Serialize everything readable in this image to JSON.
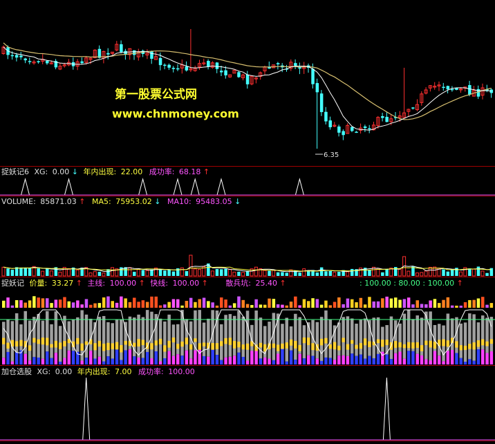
{
  "watermark": {
    "title": "第一股票公式网",
    "url": "www.chnmoney.com"
  },
  "colors": {
    "up": "#ff3030",
    "down": "#44ffff",
    "ma_yellow": "#d8c070",
    "ma_white": "#ffffff",
    "separator": "#c00000",
    "label_white": "#e0e0e0",
    "label_yellow": "#ffff40",
    "label_magenta": "#ff55ff",
    "label_cyan": "#44ffff"
  },
  "panels": {
    "price": {
      "low_marker": "6.35"
    },
    "panel1": {
      "name": "捉妖记6",
      "xg_label": "XG:",
      "xg_value": "0.00",
      "xg_arrow": "↓",
      "year_label": "年内出现:",
      "year_value": "22.00",
      "rate_label": "成功率:",
      "rate_value": "68.18",
      "rate_arrow": "↑"
    },
    "volume": {
      "vol_label": "VOLUME:",
      "vol_value": "85871.03",
      "vol_arrow": "↑",
      "ma5_label": "MA5:",
      "ma5_value": "75953.02",
      "ma5_arrow": "↓",
      "ma10_label": "MA10:",
      "ma10_value": "95483.05",
      "ma10_arrow": "↓"
    },
    "panel3": {
      "name": "捉妖记",
      "price_label": "价量:",
      "price_value": "33.27",
      "price_arrow": "↑",
      "main_label": "主线:",
      "main_value": "100.00",
      "main_arrow": "↑",
      "fast_label": "快线:",
      "fast_value": "100.00",
      "fast_arrow": "↑",
      "retail_label": "散兵坑:",
      "retail_value": "25.40",
      "retail_arrow": "↑",
      "extra": ": 100.00 : 80.00 : 100.00",
      "extra_arrow": "↑"
    },
    "panel4": {
      "name": "加仓选股",
      "xg_label": "XG:",
      "xg_value": "0.00",
      "year_label": "年内出现:",
      "year_value": "7.00",
      "rate_label": "成功率:",
      "rate_value": "100.00"
    }
  },
  "chart_data": {
    "type": "candlestick",
    "note_low": "6.35",
    "signal1_bars": [
      5,
      15,
      32,
      40,
      44,
      50,
      68
    ],
    "signal4_bars": [
      19,
      88
    ]
  }
}
